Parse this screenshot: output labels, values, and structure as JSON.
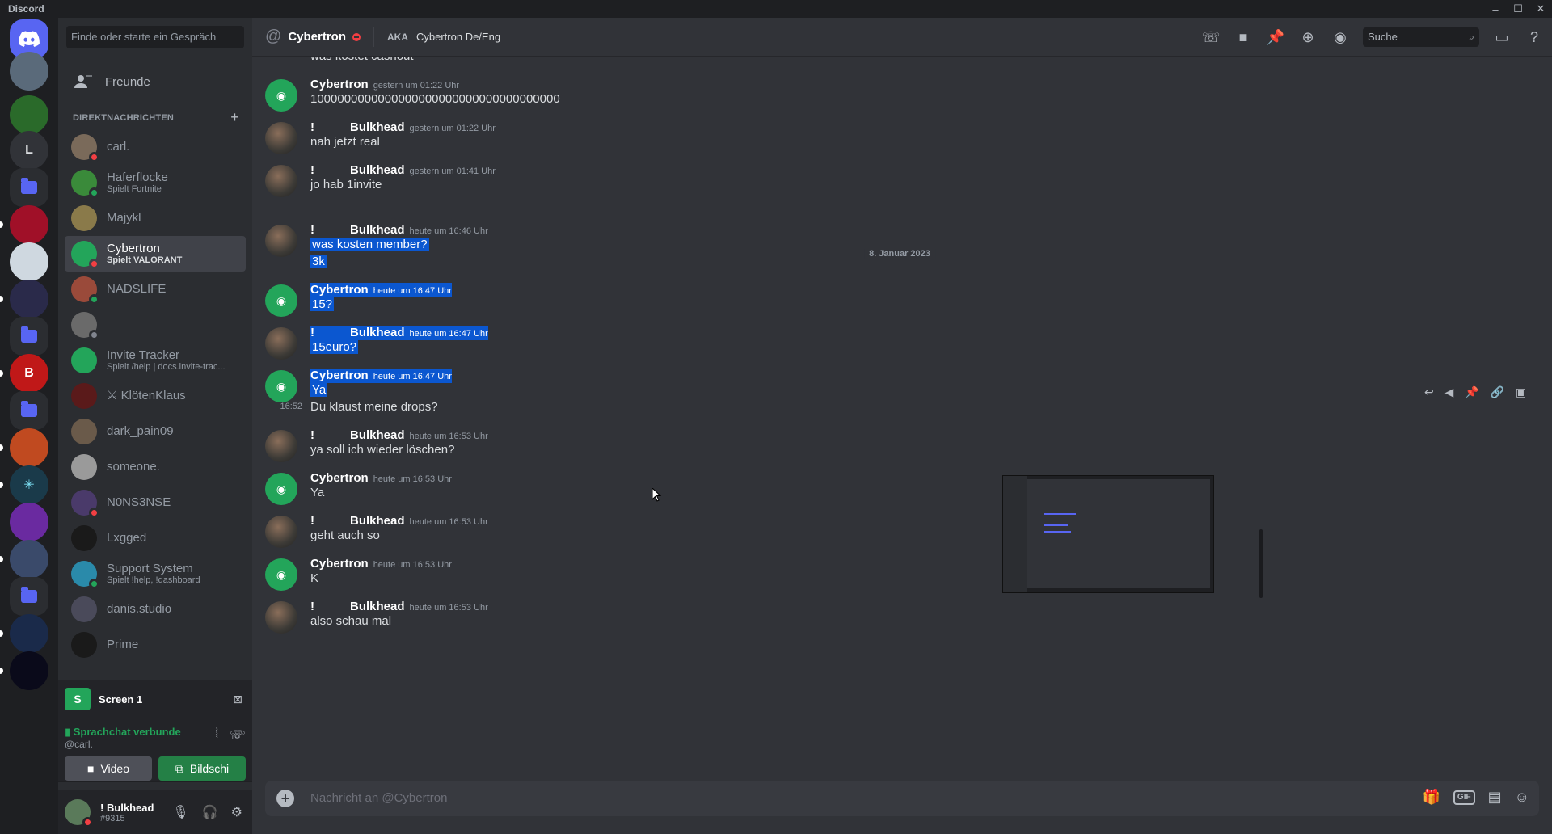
{
  "window": {
    "title": "Discord",
    "controls": [
      "–",
      "☐",
      "✕"
    ]
  },
  "sidebar": {
    "search_placeholder": "Finde oder starte ein Gespräch",
    "friends_label": "Freunde",
    "dm_header": "DIREKTNACHRICHTEN",
    "dms": [
      {
        "name": "carl.",
        "sub": "",
        "status": "dnd",
        "color": "#7a6a5a"
      },
      {
        "name": "Haferflocke",
        "sub": "Spielt Fortnite",
        "status": "on",
        "color": "#3a8a3a"
      },
      {
        "name": "Majykl",
        "sub": "",
        "status": "none",
        "color": "#8a7a4a"
      },
      {
        "name": "Cybertron",
        "sub": "Spielt VALORANT",
        "status": "dnd",
        "color": "#23a55a"
      },
      {
        "name": "NADSLIFE",
        "sub": "",
        "status": "on",
        "color": "#9a4a3a"
      },
      {
        "name": "",
        "sub": "",
        "status": "off",
        "color": "#6a6a6a"
      },
      {
        "name": "Invite Tracker",
        "sub": "Spielt /help | docs.invite-trac...",
        "status": "none",
        "color": "#23a55a"
      },
      {
        "name": "⚔ KlötenKlaus",
        "sub": "",
        "status": "none",
        "color": "#5a1a1a"
      },
      {
        "name": "dark_pain09",
        "sub": "",
        "status": "none",
        "color": "#6a5a4a"
      },
      {
        "name": "someone.",
        "sub": "",
        "status": "none",
        "color": "#9a9a9a"
      },
      {
        "name": "N0NS3NSE",
        "sub": "",
        "status": "dnd",
        "color": "#4a3a6a"
      },
      {
        "name": "Lxgged",
        "sub": "",
        "status": "none",
        "color": "#1a1a1a"
      },
      {
        "name": "Support System",
        "sub": "Spielt !help, !dashboard",
        "status": "on",
        "color": "#2a8aaa"
      },
      {
        "name": "danis.studio",
        "sub": "",
        "status": "none",
        "color": "#4a4a5a"
      },
      {
        "name": "Prime",
        "sub": "",
        "status": "none",
        "color": "#1a1a1a"
      }
    ]
  },
  "voice": {
    "screen_label": "Screen 1",
    "connected": "Sprachchat verbunde",
    "user": "@carl.",
    "video_label": "Video",
    "share_label": "Bildschi"
  },
  "user": {
    "name": "! Bulkhead",
    "tag": "#9315"
  },
  "header": {
    "channel_name": "Cybertron",
    "aka_label": "AKA",
    "aka_value": "Cybertron De/Eng",
    "search_placeholder": "Suche"
  },
  "messages": {
    "top_text": "was kostet cashout",
    "date_divider": "8. Januar 2023",
    "list": [
      {
        "author": "Cybertron",
        "prefix": "",
        "ts": "gestern um 01:22 Uhr",
        "lines": [
          "1000000000000000000000000000000000000"
        ]
      },
      {
        "author": "Bulkhead",
        "prefix": "!",
        "ts": "gestern um 01:22 Uhr",
        "lines": [
          "nah jetzt real"
        ]
      },
      {
        "author": "Bulkhead",
        "prefix": "!",
        "ts": "gestern um 01:41 Uhr",
        "lines": [
          "jo hab 1invite"
        ]
      },
      {
        "author": "Bulkhead",
        "prefix": "!",
        "ts": "heute um 16:46 Uhr",
        "lines": [
          "was kosten member?",
          "3k"
        ]
      },
      {
        "author": "Cybertron",
        "prefix": "",
        "ts": "heute um 16:47 Uhr",
        "lines": [
          "15?"
        ]
      },
      {
        "author": "Bulkhead",
        "prefix": "!",
        "ts": "heute um 16:47 Uhr",
        "lines": [
          "15euro?"
        ]
      },
      {
        "author": "Cybertron",
        "prefix": "",
        "ts": "heute um 16:47 Uhr",
        "lines": [
          "Ya"
        ]
      },
      {
        "author": "Bulkhead",
        "prefix": "!",
        "ts": "heute um 16:53 Uhr",
        "lines": [
          "ya soll ich wieder löschen?"
        ]
      },
      {
        "author": "Cybertron",
        "prefix": "",
        "ts": "heute um 16:53 Uhr",
        "lines": [
          "Ya"
        ]
      },
      {
        "author": "Bulkhead",
        "prefix": "!",
        "ts": "heute um 16:53 Uhr",
        "lines": [
          "geht auch so"
        ]
      },
      {
        "author": "Cybertron",
        "prefix": "",
        "ts": "heute um 16:53 Uhr",
        "lines": [
          "K"
        ]
      },
      {
        "author": "Bulkhead",
        "prefix": "!",
        "ts": "heute um 16:53 Uhr",
        "lines": [
          "also schau mal"
        ]
      }
    ],
    "continuation": {
      "time": "16:52",
      "text": "Du klaust meine drops?"
    }
  },
  "composer": {
    "placeholder": "Nachricht an @Cybertron",
    "gif_label": "GIF"
  }
}
